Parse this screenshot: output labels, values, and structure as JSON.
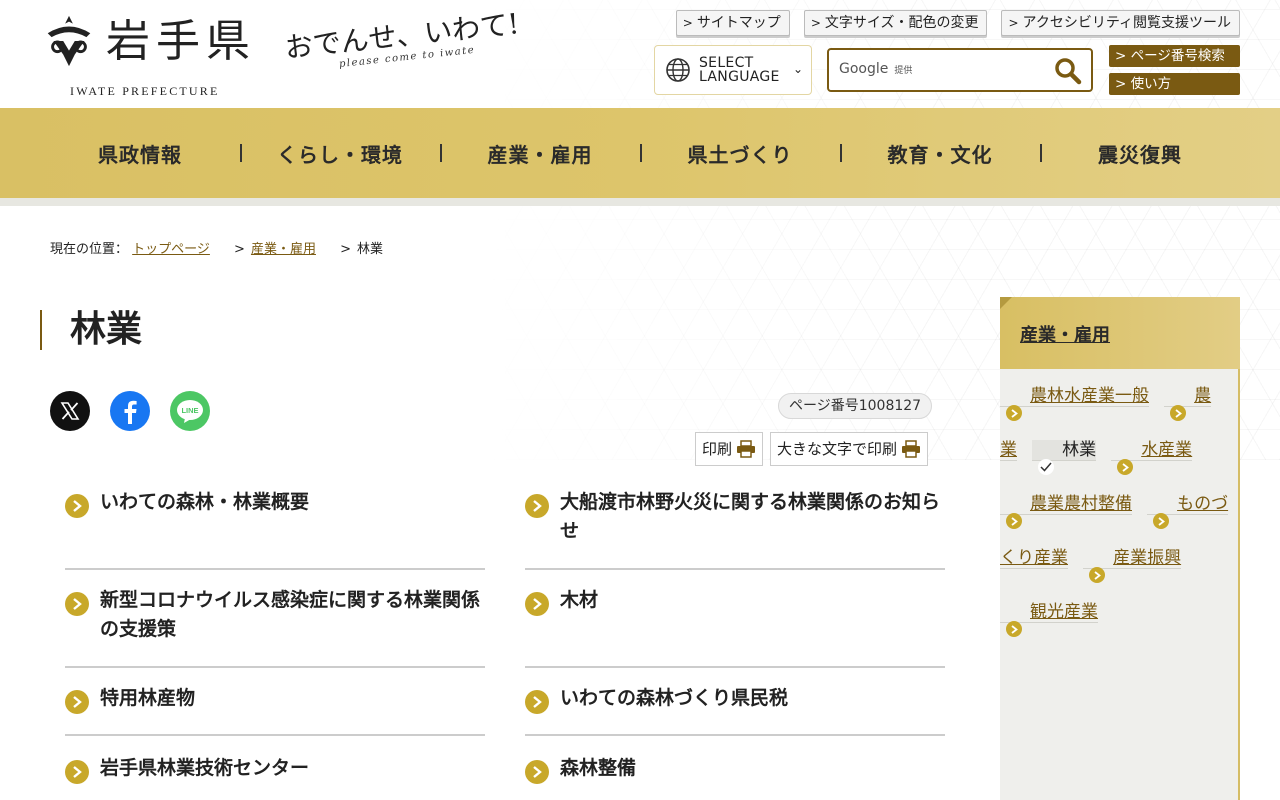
{
  "header": {
    "logo_name": "岩手県",
    "logo_sub": "IWATE PREFECTURE",
    "tagline": "おでんせ、いわて!",
    "tagline_sub": "please come to iwate",
    "util_links": [
      "サイトマップ",
      "文字サイズ・配色の変更",
      "アクセシビリティ閲覧支援ツール"
    ],
    "language_line1": "SELECT",
    "language_line2": "LANGUAGE",
    "search_brand": "Google",
    "search_brand_sub": "提供",
    "search_value": "",
    "page_search": "ページ番号検索",
    "howto": "使い方"
  },
  "gnav": {
    "items": [
      "県政情報",
      "くらし・環境",
      "産業・雇用",
      "県土づくり",
      "教育・文化",
      "震災復興"
    ]
  },
  "breadcrumb": {
    "prefix": "現在の位置：",
    "top": "トップページ",
    "sep": ">",
    "category": "産業・雇用",
    "current": "林業"
  },
  "page": {
    "title": "林業",
    "page_number": "ページ番号1008127",
    "print": "印刷",
    "print_large": "大きな文字で印刷"
  },
  "links": [
    "いわての森林・林業概要",
    "大船渡市林野火災に関する林業関係のお知らせ",
    "新型コロナウイルス感染症に関する林業関係の支援策",
    "木材",
    "特用林産物",
    "いわての森林づくり県民税",
    "岩手県林業技術センター",
    "森林整備"
  ],
  "sidebar": {
    "heading": "産業・雇用",
    "items": [
      "農林水産業一般",
      "農業",
      "林業",
      "水産業",
      "農業農村整備",
      "ものづくり産業",
      "産業振興",
      "観光産業"
    ],
    "current_index": 2
  },
  "colors": {
    "gold": "#d9c064",
    "brown": "#7a5a12",
    "bullet": "#c8a82a"
  }
}
